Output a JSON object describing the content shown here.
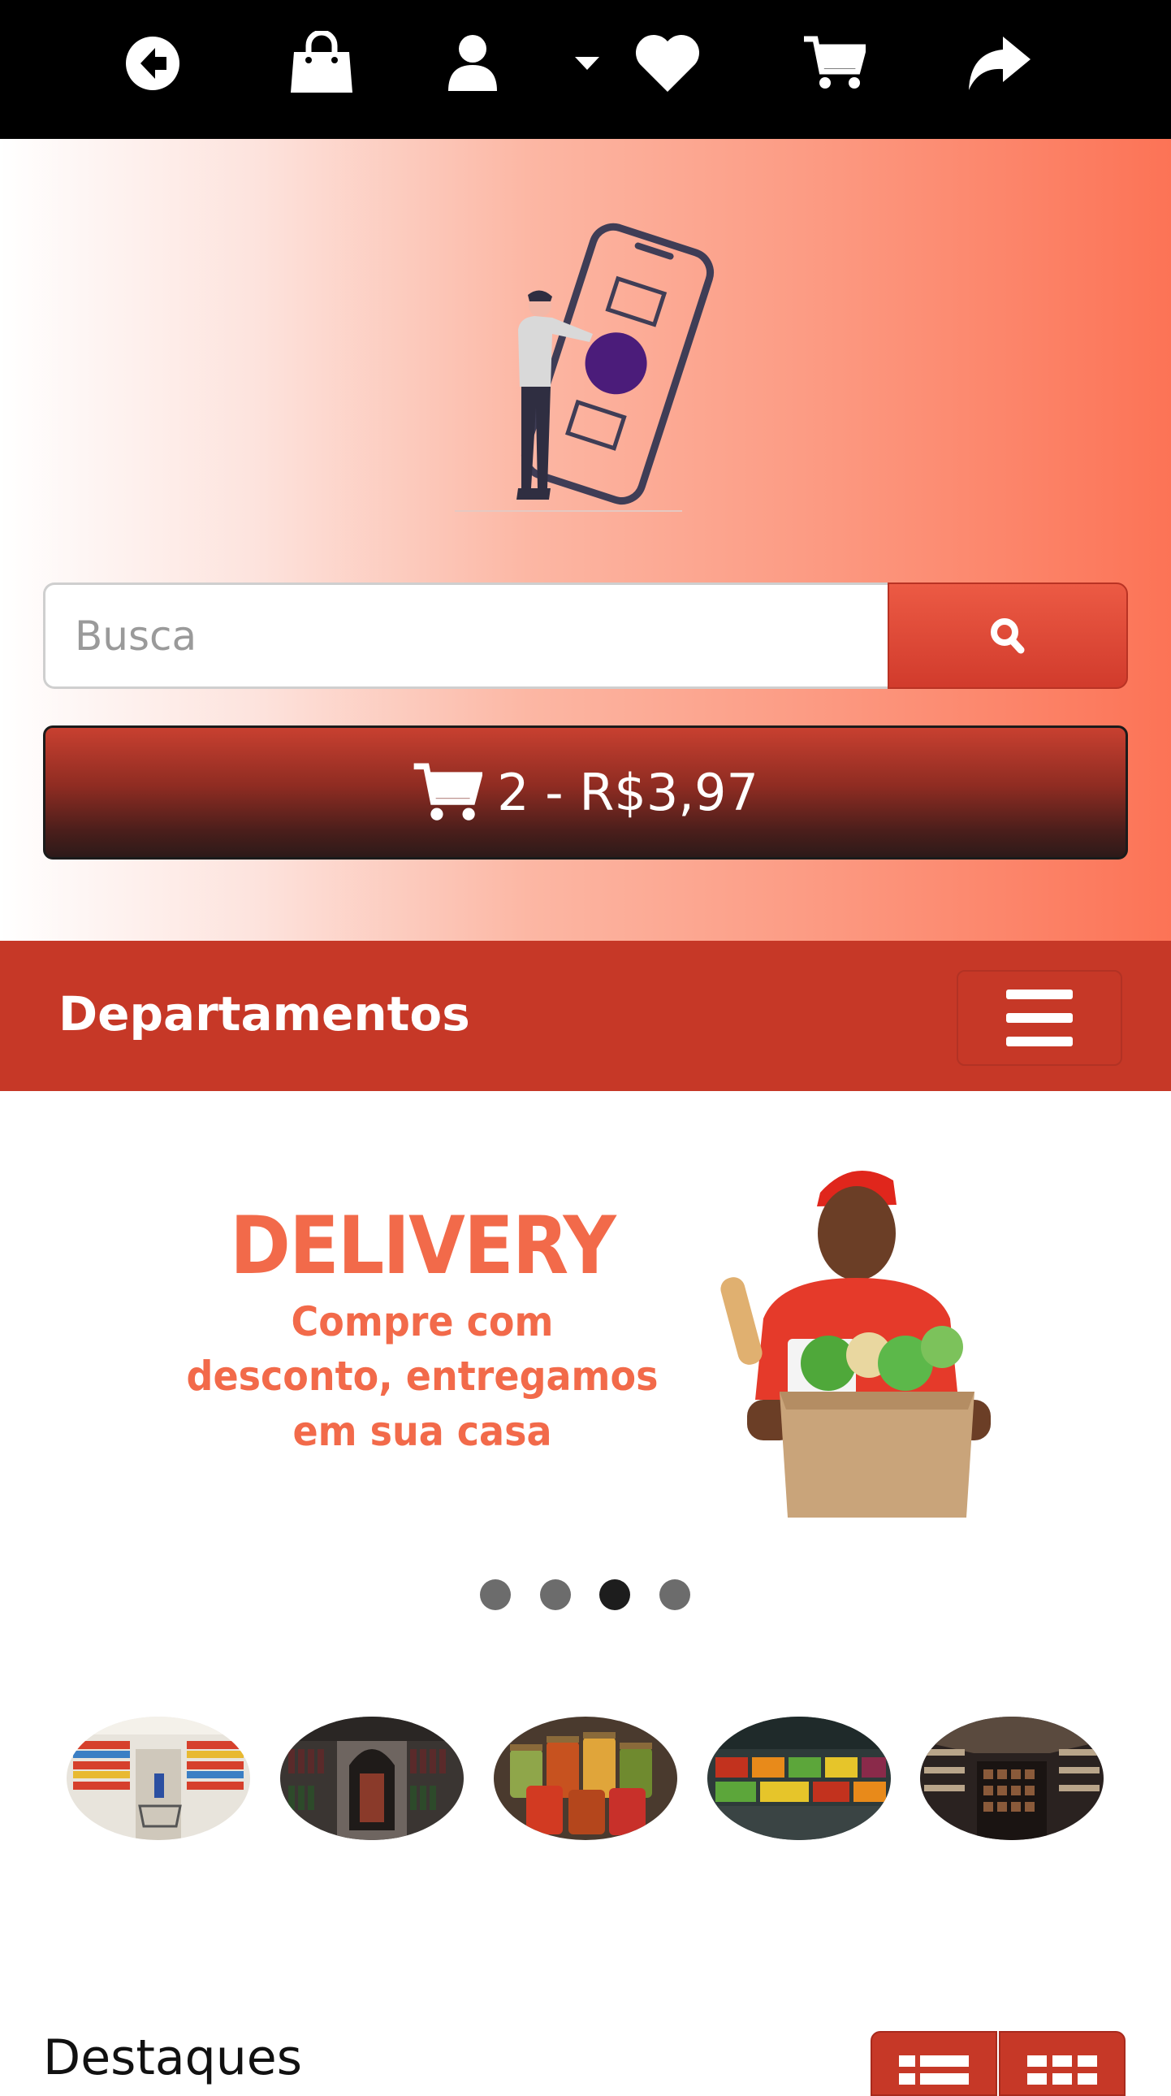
{
  "topbar": {
    "icons": [
      "back-icon",
      "shopping-bag-icon",
      "user-icon",
      "caret-down-icon",
      "heart-icon",
      "cart-icon",
      "share-icon"
    ]
  },
  "search": {
    "placeholder": "Busca",
    "button_icon": "search-icon"
  },
  "cart_summary": {
    "text": "2 - R$3,97",
    "icon": "cart-icon"
  },
  "departments": {
    "title": "Departamentos",
    "menu_icon": "hamburger-icon"
  },
  "banner": {
    "headline": "DELIVERY",
    "subline_1": "Compre com",
    "subline_2": "desconto, entregamos",
    "subline_3": "em sua casa",
    "slides_count": 4,
    "active_slide": 3
  },
  "categories": [
    "supermarket-aisle",
    "wine-shelves",
    "preserves-jars",
    "produce-display",
    "store-interior"
  ],
  "featured": {
    "title": "Destaques",
    "view_icons": [
      "list-view-icon",
      "grid-view-icon"
    ]
  },
  "colors": {
    "topbar": "#000000",
    "accent": "#c63827",
    "banner_text": "#f26a4a",
    "hero_gradient_end": "#fc7356"
  }
}
